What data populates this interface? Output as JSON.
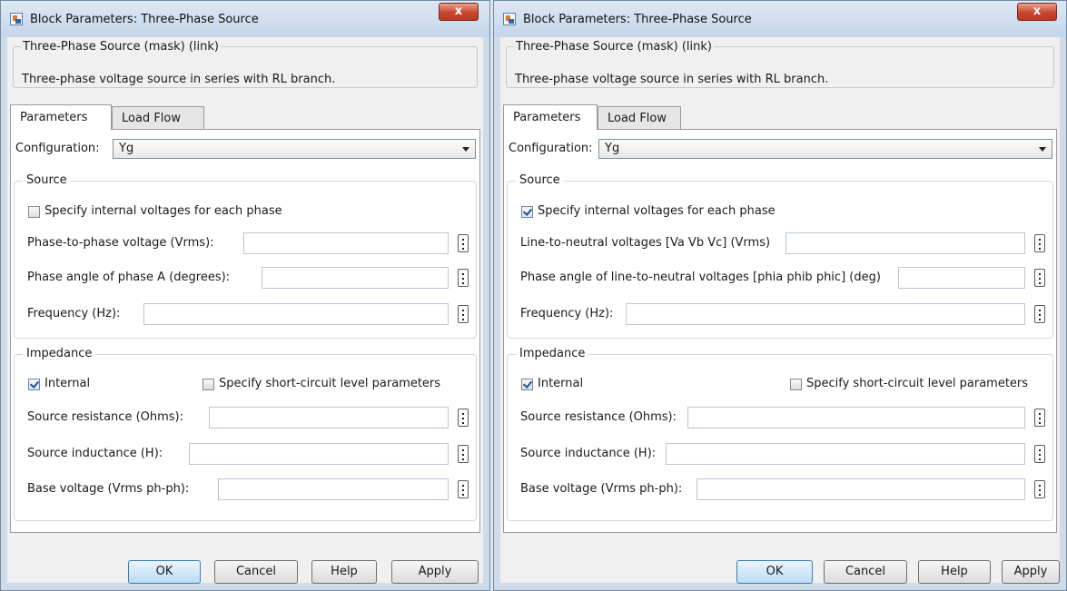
{
  "windows": [
    {
      "title": "Block Parameters: Three-Phase Source",
      "close_label": "x",
      "mask_title": "Three-Phase Source (mask) (link)",
      "description": "Three-phase voltage source in series with RL branch.",
      "tabs": [
        "Parameters",
        "Load Flow"
      ],
      "configuration": {
        "label": "Configuration:",
        "value": "Yg"
      },
      "source_group": {
        "legend": "Source",
        "checkbox": {
          "label": "Specify internal voltages for each phase",
          "checked": false
        },
        "fields": [
          {
            "label": "Phase-to-phase voltage (Vrms):",
            "value": ""
          },
          {
            "label": "Phase angle of phase A (degrees):",
            "value": ""
          },
          {
            "label": "Frequency (Hz):",
            "value": ""
          }
        ]
      },
      "impedance_group": {
        "legend": "Impedance",
        "internal": {
          "label": "Internal",
          "checked": true
        },
        "short_circuit": {
          "label": "Specify short-circuit level parameters",
          "checked": false
        },
        "fields": [
          {
            "label": "Source resistance (Ohms):",
            "value": ""
          },
          {
            "label": "Source inductance (H):",
            "value": ""
          },
          {
            "label": "Base voltage (Vrms ph-ph):",
            "value": ""
          }
        ]
      },
      "buttons": [
        "OK",
        "Cancel",
        "Help",
        "Apply"
      ]
    },
    {
      "title": "Block Parameters: Three-Phase Source",
      "close_label": "x",
      "mask_title": "Three-Phase Source (mask) (link)",
      "description": "Three-phase voltage source in series with RL branch.",
      "tabs": [
        "Parameters",
        "Load Flow"
      ],
      "configuration": {
        "label": "Configuration:",
        "value": "Yg"
      },
      "source_group": {
        "legend": "Source",
        "checkbox": {
          "label": "Specify internal voltages for each phase",
          "checked": true
        },
        "fields": [
          {
            "label": "Line-to-neutral voltages [Va Vb Vc] (Vrms)",
            "value": ""
          },
          {
            "label": "Phase angle of line-to-neutral voltages [phia phib phic] (deg)",
            "value": ""
          },
          {
            "label": "Frequency (Hz):",
            "value": ""
          }
        ]
      },
      "impedance_group": {
        "legend": "Impedance",
        "internal": {
          "label": "Internal",
          "checked": true
        },
        "short_circuit": {
          "label": "Specify short-circuit level parameters",
          "checked": false
        },
        "fields": [
          {
            "label": "Source resistance (Ohms):",
            "value": ""
          },
          {
            "label": "Source inductance (H):",
            "value": ""
          },
          {
            "label": "Base voltage (Vrms ph-ph):",
            "value": ""
          }
        ]
      },
      "buttons": [
        "OK",
        "Cancel",
        "Help",
        "Apply"
      ]
    }
  ]
}
